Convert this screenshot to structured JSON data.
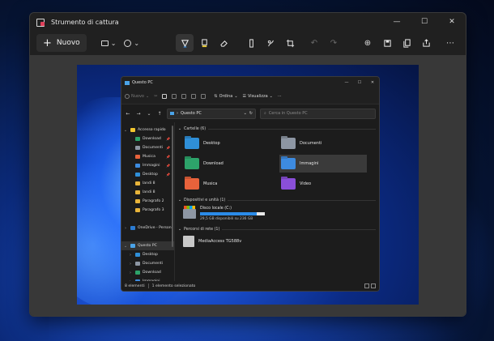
{
  "snip": {
    "title": "Strumento di cattura",
    "new_label": "Nuovo",
    "colors": {
      "accent": "#e0405a"
    }
  },
  "explorer": {
    "title": "Questo PC",
    "cmd": {
      "new": "Nuovo",
      "sort": "Ordina",
      "view": "Visualizza"
    },
    "address": "Questo PC",
    "search_placeholder": "Cerca in Questo PC",
    "sidebar": [
      {
        "label": "Accesso rapido",
        "icon": "star-icon",
        "color": "#f2c62f",
        "chev": "⌄",
        "pin": false,
        "sel": false,
        "indent": 0
      },
      {
        "label": "Download",
        "icon": "download-icon",
        "color": "#2da36a",
        "chev": "",
        "pin": true,
        "sel": false,
        "indent": 1
      },
      {
        "label": "Documenti",
        "icon": "documents-icon",
        "color": "#8d96a3",
        "chev": "",
        "pin": true,
        "sel": false,
        "indent": 1
      },
      {
        "label": "Musica",
        "icon": "music-icon",
        "color": "#e8623b",
        "chev": "",
        "pin": true,
        "sel": false,
        "indent": 1
      },
      {
        "label": "Immagini",
        "icon": "pictures-icon",
        "color": "#3d8be0",
        "chev": "",
        "pin": true,
        "sel": false,
        "indent": 1
      },
      {
        "label": "Desktop",
        "icon": "desktop-icon",
        "color": "#2f8fd8",
        "chev": "",
        "pin": true,
        "sel": false,
        "indent": 1
      },
      {
        "label": "landi 8",
        "icon": "folder-icon",
        "color": "#e8b43a",
        "chev": "",
        "pin": false,
        "sel": false,
        "indent": 1
      },
      {
        "label": "landi 8",
        "icon": "folder-icon",
        "color": "#e8b43a",
        "chev": "",
        "pin": false,
        "sel": false,
        "indent": 1
      },
      {
        "label": "Paragrafo 2",
        "icon": "folder-icon",
        "color": "#e8b43a",
        "chev": "",
        "pin": false,
        "sel": false,
        "indent": 1
      },
      {
        "label": "Paragrafo 3",
        "icon": "folder-icon",
        "color": "#e8b43a",
        "chev": "",
        "pin": false,
        "sel": false,
        "indent": 1
      },
      {
        "label": "",
        "icon": "",
        "color": "",
        "chev": "",
        "pin": false,
        "sel": false,
        "indent": 0
      },
      {
        "label": "OneDrive - Person",
        "icon": "cloud-icon",
        "color": "#2b7cd3",
        "chev": "›",
        "pin": false,
        "sel": false,
        "indent": 0
      },
      {
        "label": "",
        "icon": "",
        "color": "",
        "chev": "",
        "pin": false,
        "sel": false,
        "indent": 0
      },
      {
        "label": "Questo PC",
        "icon": "pc-icon",
        "color": "#4aa3e8",
        "chev": "⌄",
        "pin": false,
        "sel": true,
        "indent": 0
      },
      {
        "label": "Desktop",
        "icon": "desktop-icon",
        "color": "#2f8fd8",
        "chev": "›",
        "pin": false,
        "sel": false,
        "indent": 1
      },
      {
        "label": "Documenti",
        "icon": "documents-icon",
        "color": "#8d96a3",
        "chev": "›",
        "pin": false,
        "sel": false,
        "indent": 1
      },
      {
        "label": "Download",
        "icon": "download-icon",
        "color": "#2da36a",
        "chev": "›",
        "pin": false,
        "sel": false,
        "indent": 1
      },
      {
        "label": "Immagini",
        "icon": "pictures-icon",
        "color": "#3d8be0",
        "chev": "›",
        "pin": false,
        "sel": false,
        "indent": 1
      }
    ],
    "groups": {
      "folders_head": "Cartelle (6)",
      "devices_head": "Dispositivi e unità (1)",
      "network_head": "Percorsi di rete (1)"
    },
    "folders": [
      {
        "label": "Desktop",
        "color": "#2f8fd8",
        "sel": false
      },
      {
        "label": "Documenti",
        "color": "#8d96a3",
        "sel": false
      },
      {
        "label": "Download",
        "color": "#2da36a",
        "sel": false
      },
      {
        "label": "Immagini",
        "color": "#3d8be0",
        "sel": true
      },
      {
        "label": "Musica",
        "color": "#e8623b",
        "sel": false
      },
      {
        "label": "Video",
        "color": "#8a4fd8",
        "sel": false
      }
    ],
    "drive": {
      "label": "Disco locale (C:)",
      "sub": "29,5 GB disponibili su 236 GB",
      "used_fraction": 0.875
    },
    "network": {
      "label": "MediaAccess TG588v"
    },
    "status": {
      "items": "8 elementi",
      "selected": "1 elemento selezionato"
    }
  }
}
